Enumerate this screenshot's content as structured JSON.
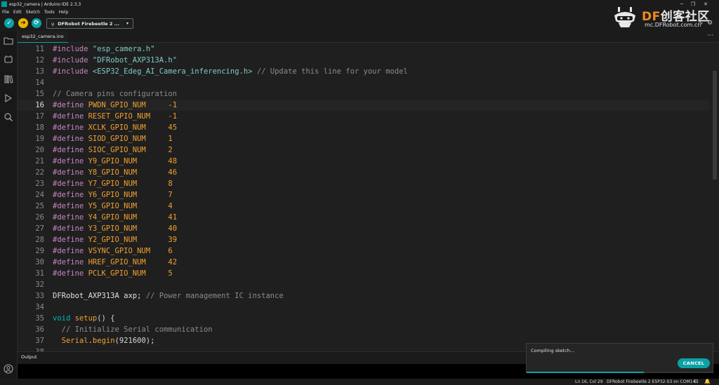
{
  "window": {
    "title": "esp32_camera | Arduino IDE 2.3.3",
    "minimize_glyph": "─",
    "maximize_glyph": "❐",
    "close_glyph": "✕"
  },
  "menu": [
    "File",
    "Edit",
    "Sketch",
    "Tools",
    "Help"
  ],
  "toolbar": {
    "verify_glyph": "✓",
    "upload_glyph": "➜",
    "debug_glyph": "⟳",
    "board_label": "DFRobot Firebeetle 2 ...",
    "board_usb_glyph": "ψ",
    "board_chevron": "▾",
    "serial_plotter_glyph": "∿",
    "serial_monitor_glyph": "⚙"
  },
  "watermark": {
    "brand_df": "DF",
    "brand_cn": "创客社区",
    "url": "mc.DFRobot.com.cn"
  },
  "tab": {
    "file_name": "esp32_camera.ino",
    "more_glyph": "···"
  },
  "code": {
    "active_line": 16,
    "lines": [
      {
        "n": "11",
        "tokens": [
          [
            "pp",
            "#include "
          ],
          [
            "str",
            "\"esp_camera.h\""
          ]
        ]
      },
      {
        "n": "12",
        "tokens": [
          [
            "pp",
            "#include "
          ],
          [
            "str",
            "\"DFRobot_AXP313A.h\""
          ]
        ]
      },
      {
        "n": "13",
        "tokens": [
          [
            "pp",
            "#include "
          ],
          [
            "str",
            "<ESP32_Edeg_AI_Camera_inferencing.h>"
          ],
          [
            "plain",
            " "
          ],
          [
            "cm",
            "// Update this line for your model"
          ]
        ]
      },
      {
        "n": "14",
        "tokens": []
      },
      {
        "n": "15",
        "tokens": [
          [
            "cm",
            "// Camera pins configuration"
          ]
        ]
      },
      {
        "n": "16",
        "tokens": [
          [
            "pp",
            "#define "
          ],
          [
            "macro",
            "PWDN_GPIO_NUM"
          ],
          [
            "plain",
            "     "
          ],
          [
            "num",
            "-1"
          ]
        ]
      },
      {
        "n": "17",
        "tokens": [
          [
            "pp",
            "#define "
          ],
          [
            "macro",
            "RESET_GPIO_NUM"
          ],
          [
            "plain",
            "    "
          ],
          [
            "num",
            "-1"
          ]
        ]
      },
      {
        "n": "18",
        "tokens": [
          [
            "pp",
            "#define "
          ],
          [
            "macro",
            "XCLK_GPIO_NUM"
          ],
          [
            "plain",
            "     "
          ],
          [
            "num",
            "45"
          ]
        ]
      },
      {
        "n": "19",
        "tokens": [
          [
            "pp",
            "#define "
          ],
          [
            "macro",
            "SIOD_GPIO_NUM"
          ],
          [
            "plain",
            "     "
          ],
          [
            "num",
            "1"
          ]
        ]
      },
      {
        "n": "20",
        "tokens": [
          [
            "pp",
            "#define "
          ],
          [
            "macro",
            "SIOC_GPIO_NUM"
          ],
          [
            "plain",
            "     "
          ],
          [
            "num",
            "2"
          ]
        ]
      },
      {
        "n": "21",
        "tokens": [
          [
            "pp",
            "#define "
          ],
          [
            "macro",
            "Y9_GPIO_NUM"
          ],
          [
            "plain",
            "       "
          ],
          [
            "num",
            "48"
          ]
        ]
      },
      {
        "n": "22",
        "tokens": [
          [
            "pp",
            "#define "
          ],
          [
            "macro",
            "Y8_GPIO_NUM"
          ],
          [
            "plain",
            "       "
          ],
          [
            "num",
            "46"
          ]
        ]
      },
      {
        "n": "23",
        "tokens": [
          [
            "pp",
            "#define "
          ],
          [
            "macro",
            "Y7_GPIO_NUM"
          ],
          [
            "plain",
            "       "
          ],
          [
            "num",
            "8"
          ]
        ]
      },
      {
        "n": "24",
        "tokens": [
          [
            "pp",
            "#define "
          ],
          [
            "macro",
            "Y6_GPIO_NUM"
          ],
          [
            "plain",
            "       "
          ],
          [
            "num",
            "7"
          ]
        ]
      },
      {
        "n": "25",
        "tokens": [
          [
            "pp",
            "#define "
          ],
          [
            "macro",
            "Y5_GPIO_NUM"
          ],
          [
            "plain",
            "       "
          ],
          [
            "num",
            "4"
          ]
        ]
      },
      {
        "n": "26",
        "tokens": [
          [
            "pp",
            "#define "
          ],
          [
            "macro",
            "Y4_GPIO_NUM"
          ],
          [
            "plain",
            "       "
          ],
          [
            "num",
            "41"
          ]
        ]
      },
      {
        "n": "27",
        "tokens": [
          [
            "pp",
            "#define "
          ],
          [
            "macro",
            "Y3_GPIO_NUM"
          ],
          [
            "plain",
            "       "
          ],
          [
            "num",
            "40"
          ]
        ]
      },
      {
        "n": "28",
        "tokens": [
          [
            "pp",
            "#define "
          ],
          [
            "macro",
            "Y2_GPIO_NUM"
          ],
          [
            "plain",
            "       "
          ],
          [
            "num",
            "39"
          ]
        ]
      },
      {
        "n": "29",
        "tokens": [
          [
            "pp",
            "#define "
          ],
          [
            "macro",
            "VSYNC_GPIO_NUM"
          ],
          [
            "plain",
            "    "
          ],
          [
            "num",
            "6"
          ]
        ]
      },
      {
        "n": "30",
        "tokens": [
          [
            "pp",
            "#define "
          ],
          [
            "macro",
            "HREF_GPIO_NUM"
          ],
          [
            "plain",
            "     "
          ],
          [
            "num",
            "42"
          ]
        ]
      },
      {
        "n": "31",
        "tokens": [
          [
            "pp",
            "#define "
          ],
          [
            "macro",
            "PCLK_GPIO_NUM"
          ],
          [
            "plain",
            "     "
          ],
          [
            "num",
            "5"
          ]
        ]
      },
      {
        "n": "32",
        "tokens": []
      },
      {
        "n": "33",
        "tokens": [
          [
            "type",
            "DFRobot_AXP313A axp; "
          ],
          [
            "cm",
            "// Power management IC instance"
          ]
        ]
      },
      {
        "n": "34",
        "tokens": []
      },
      {
        "n": "35",
        "tokens": [
          [
            "void",
            "void "
          ],
          [
            "fn",
            "setup"
          ],
          [
            "plain",
            "() {"
          ]
        ]
      },
      {
        "n": "36",
        "tokens": [
          [
            "plain",
            "  "
          ],
          [
            "cm",
            "// Initialize Serial communication"
          ]
        ]
      },
      {
        "n": "37",
        "tokens": [
          [
            "plain",
            "  "
          ],
          [
            "fn",
            "Serial"
          ],
          [
            "plain",
            "."
          ],
          [
            "fn",
            "begin"
          ],
          [
            "plain",
            "(921600);"
          ]
        ]
      },
      {
        "n": "38",
        "tokens": []
      }
    ]
  },
  "output": {
    "title": "Output"
  },
  "notification": {
    "text": "Compiling sketch...",
    "cancel_label": "CANCEL",
    "progress_fraction": 0.63
  },
  "status": {
    "position": "Ln 16, Col 29",
    "board_port": "DFRobot Firebeetle 2 ESP32-S3 on COM14",
    "terminal_glyph": "⊟",
    "bell_glyph": "🔔"
  },
  "colors": {
    "accent": "#0ca1a6",
    "upload": "#f0b400",
    "macro": "#f0a030",
    "string": "#7fcbc7",
    "comment": "#8b8b8b",
    "brand_orange": "#f08a1c"
  }
}
